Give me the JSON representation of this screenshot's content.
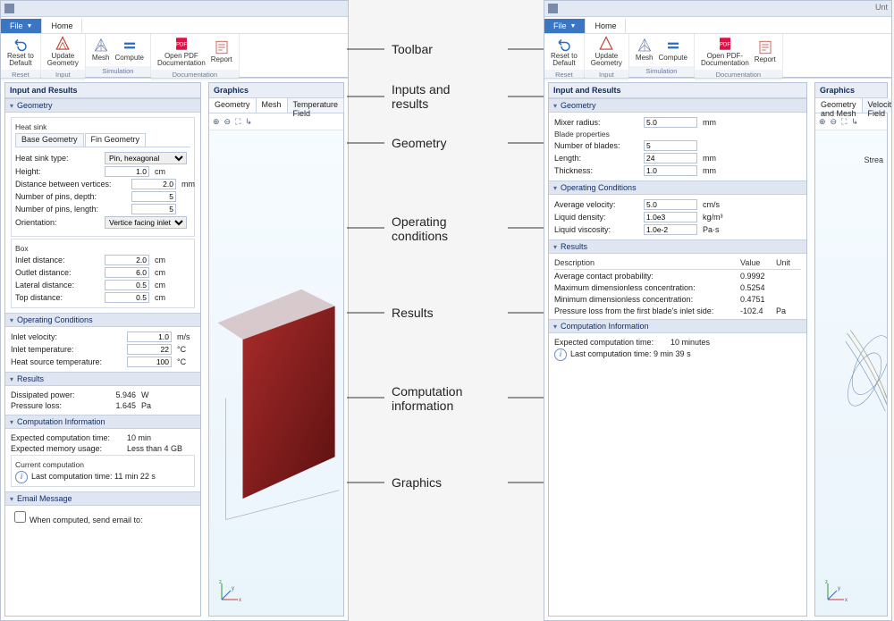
{
  "menu": {
    "file": "File",
    "home": "Home"
  },
  "ribbon": {
    "reset": "Reset to\nDefault",
    "update": "Update\nGeometry",
    "mesh": "Mesh",
    "compute": "Compute",
    "pdf_left": "Open PDF\nDocumentation",
    "pdf_right": "Open PDF-\nDocumentation",
    "report": "Report",
    "grp_reset": "Reset",
    "grp_sim": "Simulation",
    "grp_input": "Input",
    "grp_doc": "Documentation"
  },
  "panels": {
    "ir": "Input and Results",
    "gfx": "Graphics"
  },
  "sections": {
    "geometry": "Geometry",
    "oper": "Operating Conditions",
    "results": "Results",
    "comp": "Computation Information",
    "email": "Email Message"
  },
  "left": {
    "heatsink": "Heat sink",
    "tab_base": "Base Geometry",
    "tab_fin": "Fin Geometry",
    "hstype_l": "Heat sink type:",
    "hstype_v": "Pin, hexagonal",
    "height_l": "Height:",
    "height_v": "1.0",
    "height_u": "cm",
    "dist_l": "Distance between vertices:",
    "dist_v": "2.0",
    "dist_u": "mm",
    "npd_l": "Number of pins, depth:",
    "npd_v": "5",
    "npl_l": "Number of pins, length:",
    "npl_v": "5",
    "orient_l": "Orientation:",
    "orient_v": "Vertice facing inlet",
    "box": "Box",
    "inlet_l": "Inlet distance:",
    "inlet_v": "2.0",
    "u_cm": "cm",
    "outlet_l": "Outlet distance:",
    "outlet_v": "6.0",
    "lat_l": "Lateral distance:",
    "lat_v": "0.5",
    "top_l": "Top distance:",
    "top_v": "0.5",
    "ivel_l": "Inlet velocity:",
    "ivel_v": "1.0",
    "ivel_u": "m/s",
    "itemp_l": "Inlet temperature:",
    "itemp_v": "22",
    "u_c": "°C",
    "hs_l": "Heat source temperature:",
    "hs_v": "100",
    "dp_l": "Dissipated power:",
    "dp_v": "5.946",
    "dp_u": "W",
    "pl_l": "Pressure loss:",
    "pl_v": "1.645",
    "pl_u": "Pa",
    "ect_l": "Expected computation time:",
    "ect_v": "10 min",
    "emu_l": "Expected memory usage:",
    "emu_v": "Less than 4 GB",
    "cur": "Current computation",
    "last": "Last computation time: 11 min 22 s",
    "email_l": "When computed, send email to:",
    "gfx_tabs": {
      "g": "Geometry",
      "m": "Mesh",
      "t": "Temperature Field"
    }
  },
  "right": {
    "title": "Unt",
    "mr_l": "Mixer radius:",
    "mr_v": "5.0",
    "u_mm": "mm",
    "bp": "Blade properties",
    "nb_l": "Number of blades:",
    "nb_v": "5",
    "len_l": "Length:",
    "len_v": "24",
    "th_l": "Thickness:",
    "th_v": "1.0",
    "av_l": "Average velocity:",
    "av_v": "5.0",
    "av_u": "cm/s",
    "ld_l": "Liquid density:",
    "ld_v": "1.0e3",
    "ld_u": "kg/m³",
    "lv_l": "Liquid viscosity:",
    "lv_v": "1.0e-2",
    "lv_u": "Pa·s",
    "res_h_desc": "Description",
    "res_h_val": "Value",
    "res_h_unit": "Unit",
    "r1_l": "Average contact probability:",
    "r1_v": "0.9992",
    "r2_l": "Maximum dimensionless concentration:",
    "r2_v": "0.5254",
    "r3_l": "Minimum dimensionless concentration:",
    "r3_v": "0.4751",
    "r4_l": "Pressure loss from the first blade's inlet side:",
    "r4_v": "-102.4",
    "r4_u": "Pa",
    "ect_l": "Expected computation time:",
    "ect_v": "10 minutes",
    "last": "Last computation time: 9 min 39 s",
    "gfx_tabs": {
      "gm": "Geometry and Mesh",
      "vf": "Velocity Field"
    },
    "stream": "Strea"
  },
  "labels": {
    "toolbar": "Toolbar",
    "inputs": "Inputs and\nresults",
    "geometry": "Geometry",
    "oper": "Operating\nconditions",
    "results": "Results",
    "comp": "Computation\ninformation",
    "graphics": "Graphics"
  }
}
